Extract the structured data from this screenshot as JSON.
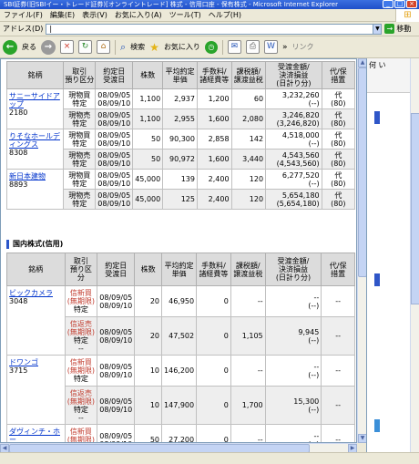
{
  "window": {
    "title": "SBI証券(旧SBIイー・トレード証券)[オンライントレード] 株式 - 信用口座 - 保有株式 - Microsoft Internet Explorer"
  },
  "menu": [
    "ファイル(F)",
    "編集(E)",
    "表示(V)",
    "お気に入り(A)",
    "ツール(T)",
    "ヘルプ(H)"
  ],
  "address": {
    "label": "アドレス(D)",
    "value": "|",
    "go": "移動"
  },
  "toolbar": {
    "back": "戻る",
    "search": "検索",
    "favorites": "お気に入り",
    "links": "リンク"
  },
  "headers": [
    "銘柄",
    "取引\n預り区分",
    "約定日\n受渡日",
    "株数",
    "平均約定\n単価",
    "手数料/\n諸経費等",
    "課税額/\n譲渡益税",
    "受渡金額/\n決済損益\n(日計り分)",
    "代/保\n措置"
  ],
  "spot": [
    {
      "name": "サニーサイドアップ",
      "code": "2180",
      "rows": [
        {
          "kind": [
            "現物買",
            "特定"
          ],
          "dates": [
            "08/09/05",
            "08/09/10"
          ],
          "qty": "1,100",
          "price": "2,937",
          "fee": "1,200",
          "tax": "60",
          "amount": [
            "3,232,260",
            "(--)"
          ],
          "dai": [
            "代",
            "(80)"
          ]
        },
        {
          "kind": [
            "現物売",
            "特定"
          ],
          "dates": [
            "08/09/05",
            "08/09/10"
          ],
          "qty": "1,100",
          "price": "2,955",
          "fee": "1,600",
          "tax": "2,080",
          "amount": [
            "3,246,820",
            "(3,246,820)"
          ],
          "dai": [
            "代",
            "(80)"
          ]
        }
      ]
    },
    {
      "name": "りそなホールディングス",
      "code": "8308",
      "rows": [
        {
          "kind": [
            "現物買",
            "特定"
          ],
          "dates": [
            "08/09/05",
            "08/09/10"
          ],
          "qty": "50",
          "price": "90,300",
          "fee": "2,858",
          "tax": "142",
          "amount": [
            "4,518,000",
            "(--)"
          ],
          "dai": [
            "代",
            "(80)"
          ]
        },
        {
          "kind": [
            "現物売",
            "特定"
          ],
          "dates": [
            "08/09/05",
            "08/09/10"
          ],
          "qty": "50",
          "price": "90,972",
          "fee": "1,600",
          "tax": "3,440",
          "amount": [
            "4,543,560",
            "(4,543,560)"
          ],
          "dai": [
            "代",
            "(80)"
          ]
        }
      ]
    },
    {
      "name": "新日本建物",
      "code": "8893",
      "rows": [
        {
          "kind": [
            "現物買",
            "特定"
          ],
          "dates": [
            "08/09/05",
            "08/09/10"
          ],
          "qty": "45,000",
          "price": "139",
          "fee": "2,400",
          "tax": "120",
          "amount": [
            "6,277,520",
            "(--)"
          ],
          "dai": [
            "代",
            "(80)"
          ]
        },
        {
          "kind": [
            "現物売",
            "特定"
          ],
          "dates": [
            "08/09/05",
            "08/09/10"
          ],
          "qty": "45,000",
          "price": "125",
          "fee": "2,400",
          "tax": "120",
          "amount": [
            "5,654,180",
            "(5,654,180)"
          ],
          "dai": [
            "代",
            "(80)"
          ]
        }
      ]
    }
  ],
  "margin_section": {
    "title": "国内株式(信用)"
  },
  "margin": [
    {
      "name": "ビックカメラ",
      "code": "3048",
      "rows": [
        {
          "kind": [
            "信新買",
            "(無期限)",
            "特定"
          ],
          "dates": [
            "08/09/05",
            "08/09/10"
          ],
          "qty": "20",
          "price": "46,950",
          "fee": "0",
          "tax": "--",
          "amount": [
            "--",
            "(--)"
          ],
          "dai": [
            "--"
          ]
        },
        {
          "kind": [
            "信返売",
            "(無期限)",
            "特定",
            "--"
          ],
          "dates": [
            "08/09/05",
            "08/09/10"
          ],
          "qty": "20",
          "price": "47,502",
          "fee": "0",
          "tax": "1,105",
          "amount": [
            "9,945",
            "(--)"
          ],
          "dai": [
            "--"
          ]
        }
      ]
    },
    {
      "name": "ドワンゴ",
      "code": "3715",
      "rows": [
        {
          "kind": [
            "信新買",
            "(無期限)",
            "特定"
          ],
          "dates": [
            "08/09/05",
            "08/09/10"
          ],
          "qty": "10",
          "price": "146,200",
          "fee": "0",
          "tax": "--",
          "amount": [
            "--",
            "(--)"
          ],
          "dai": [
            "--"
          ]
        },
        {
          "kind": [
            "信返売",
            "(無期限)",
            "特定",
            "--"
          ],
          "dates": [
            "08/09/05",
            "08/09/10"
          ],
          "qty": "10",
          "price": "147,900",
          "fee": "0",
          "tax": "1,700",
          "amount": [
            "15,300",
            "(--)"
          ],
          "dai": [
            "--"
          ]
        }
      ]
    },
    {
      "name": "ダヴィンチ・ホー",
      "code": "",
      "rows": [
        {
          "kind": [
            "信新買",
            "(無期限)",
            "特定"
          ],
          "dates": [
            "08/09/05",
            "08/09/10"
          ],
          "qty": "50",
          "price": "27,200",
          "fee": "0",
          "tax": "--",
          "amount": [
            "--",
            "(--)"
          ],
          "dai": [
            "--"
          ]
        }
      ]
    }
  ],
  "right_pane": {
    "header": "何 い"
  },
  "status": {
    "text": ""
  },
  "colors": {
    "title_bar": "#2453c8",
    "link": "#0033cc",
    "section_bar": "#2b55c9",
    "header_bg": "#dcdcdc",
    "margin_kind": "#c0392b"
  }
}
